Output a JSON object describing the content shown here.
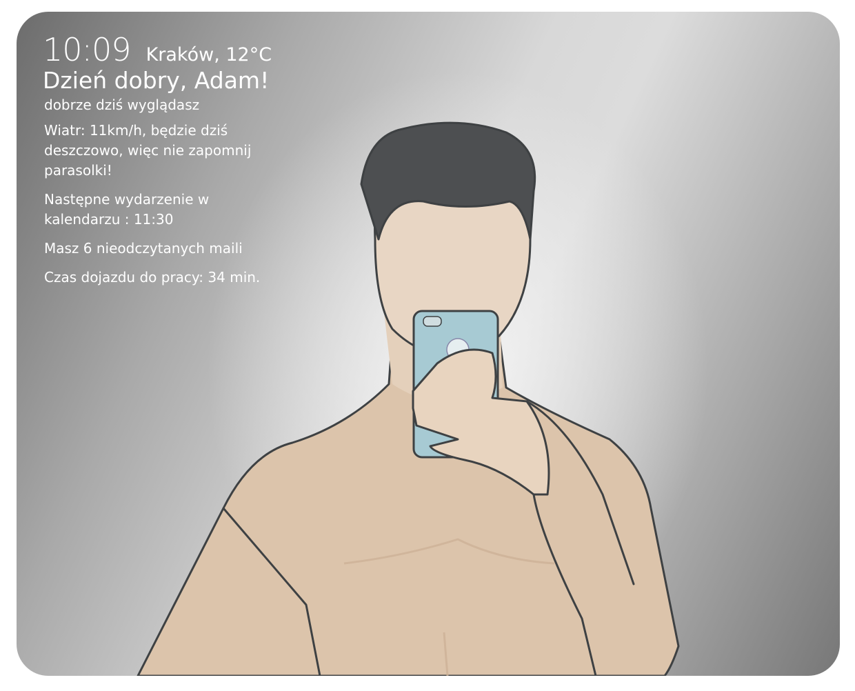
{
  "header": {
    "time": "10:09",
    "location_weather": "Kraków, 12°C",
    "greeting": "Dzień dobry, Adam!"
  },
  "messages": [
    "dobrze dziś wyglądasz",
    "Wiatr: 11km/h, będzie dziś deszczowo, więc nie zapomnij parasolki!",
    "Następne wydarzenie w kalendarzu : 11:30",
    "Masz 6 nieodczytanych maili",
    "Czas dojazdu do pracy: 34 min."
  ],
  "colors": {
    "text": "#ffffff",
    "skin": "#e2cbb2",
    "hair": "#4a4c4e",
    "phone": "#9cc4d0"
  }
}
